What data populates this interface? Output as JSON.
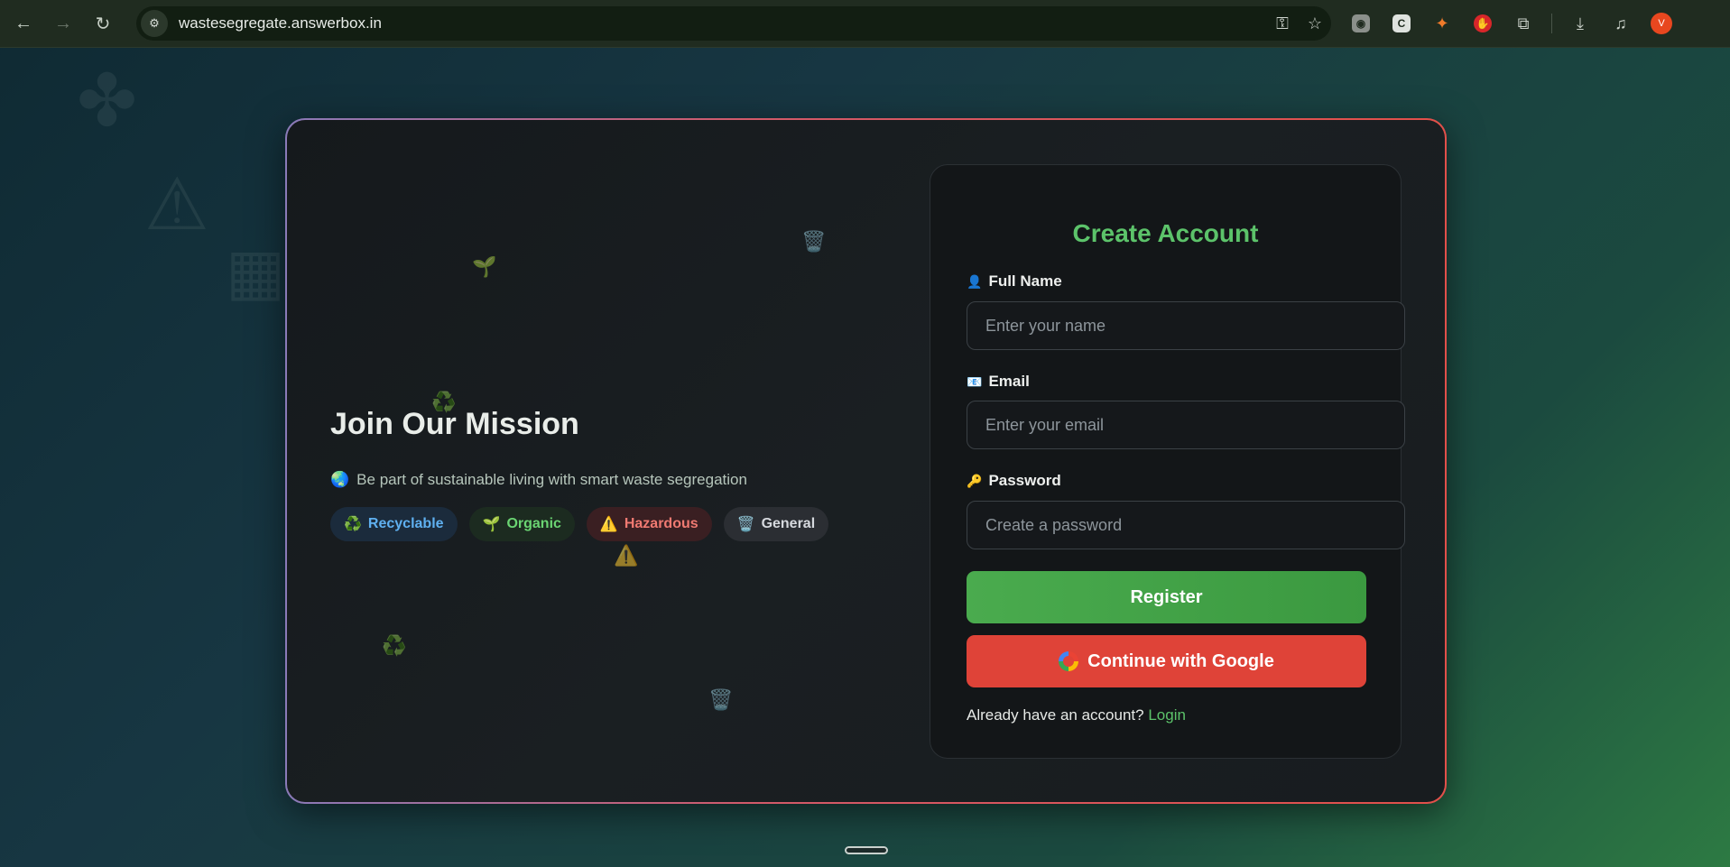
{
  "browser": {
    "url": "wastesegregate.answerbox.in",
    "avatar_letter": "V"
  },
  "mission": {
    "title": "Join Our Mission",
    "tagline": "Be part of sustainable living with smart waste segregation",
    "tagline_icon": "🌏",
    "chips": [
      {
        "icon": "♻️",
        "label": "Recyclable"
      },
      {
        "icon": "🌱",
        "label": "Organic"
      },
      {
        "icon": "⚠️",
        "label": "Hazardous"
      },
      {
        "icon": "🗑️",
        "label": "General"
      }
    ]
  },
  "form": {
    "title": "Create Account",
    "full_name": {
      "icon": "👤",
      "label": "Full Name",
      "placeholder": "Enter your name"
    },
    "email": {
      "icon": "📧",
      "label": "Email",
      "placeholder": "Enter your email"
    },
    "password": {
      "icon": "🔑",
      "label": "Password",
      "placeholder": "Create a password"
    },
    "register_label": "Register",
    "google_label": "Continue with Google",
    "login_prompt": "Already have an account?",
    "login_link": "Login"
  },
  "colors": {
    "accent_green": "#5cc36a",
    "register_bg": "#4aab4e",
    "google_bg": "#df4338"
  }
}
